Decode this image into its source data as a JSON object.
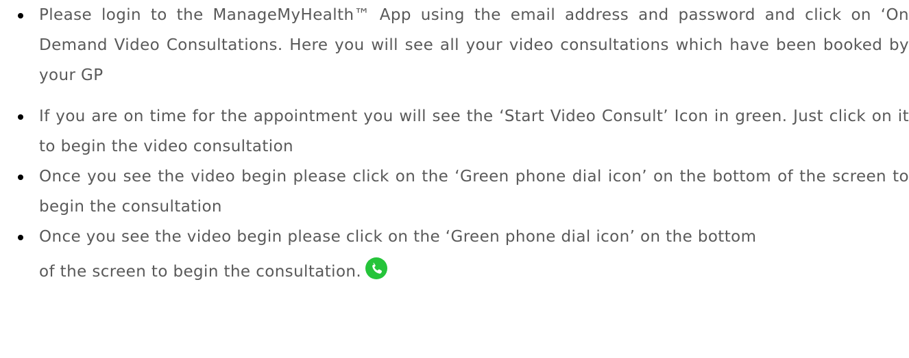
{
  "bullets": [
    {
      "text": "Please login to the ManageMyHealth™ App using the email address and password and click on ‘On Demand Video Consultations. Here you will see all your video consultations which have been booked by your GP"
    },
    {
      "text": "If you are on time for the appointment you will see the ‘Start Video Consult’ Icon in green. Just click on it to begin the video consultation"
    },
    {
      "text": "Once you see the video begin please click on the ‘Green phone dial icon’ on the bottom of the screen to begin the consultation"
    },
    {
      "text_line1": "Once you see the video begin please click on the ‘Green phone dial icon’ on the bottom",
      "text_line2": "of the screen to begin the consultation.",
      "icon": "phone-dial-icon"
    }
  ],
  "colors": {
    "text": "#595959",
    "bullet": "#000000",
    "phone_icon_bg": "#25c43a",
    "phone_icon_fg": "#ffffff"
  }
}
